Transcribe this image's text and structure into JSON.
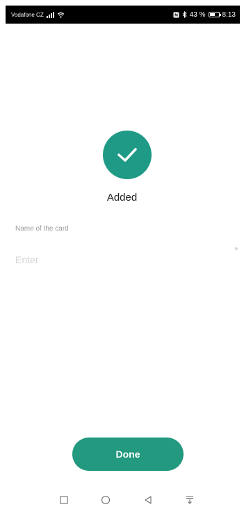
{
  "status_bar": {
    "carrier": "Vodafone CZ",
    "battery_percent": "43 %",
    "time": "8:13",
    "icons": [
      "signal-icon",
      "wifi-icon",
      "nfc-icon",
      "bluetooth-icon",
      "battery-icon"
    ]
  },
  "result": {
    "icon": "checkmark-icon",
    "title": "Added",
    "color": "#1f9a86"
  },
  "form": {
    "card_name_label": "Name of the card",
    "card_name_placeholder": "Enter",
    "card_name_value": ""
  },
  "actions": {
    "done_label": "Done",
    "button_color": "#23997f"
  },
  "navigation": {
    "buttons": [
      "recent-apps-icon",
      "home-icon",
      "back-icon",
      "notification-pull-icon"
    ]
  }
}
